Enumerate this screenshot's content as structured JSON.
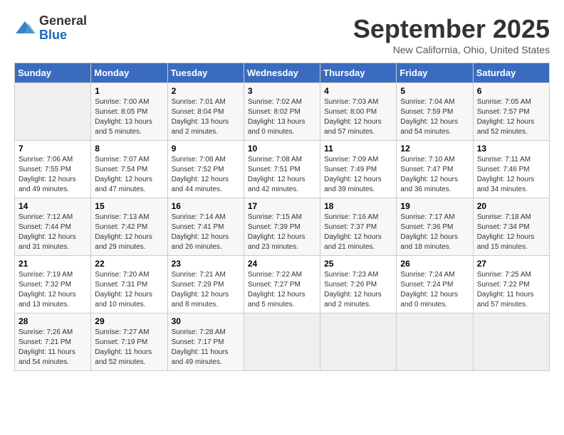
{
  "header": {
    "logo_line1": "General",
    "logo_line2": "Blue",
    "month_title": "September 2025",
    "location": "New California, Ohio, United States"
  },
  "days_of_week": [
    "Sunday",
    "Monday",
    "Tuesday",
    "Wednesday",
    "Thursday",
    "Friday",
    "Saturday"
  ],
  "weeks": [
    [
      {
        "day": "",
        "empty": true
      },
      {
        "day": "1",
        "sunrise": "7:00 AM",
        "sunset": "8:05 PM",
        "daylight": "13 hours and 5 minutes."
      },
      {
        "day": "2",
        "sunrise": "7:01 AM",
        "sunset": "8:04 PM",
        "daylight": "13 hours and 2 minutes."
      },
      {
        "day": "3",
        "sunrise": "7:02 AM",
        "sunset": "8:02 PM",
        "daylight": "13 hours and 0 minutes."
      },
      {
        "day": "4",
        "sunrise": "7:03 AM",
        "sunset": "8:00 PM",
        "daylight": "12 hours and 57 minutes."
      },
      {
        "day": "5",
        "sunrise": "7:04 AM",
        "sunset": "7:59 PM",
        "daylight": "12 hours and 54 minutes."
      },
      {
        "day": "6",
        "sunrise": "7:05 AM",
        "sunset": "7:57 PM",
        "daylight": "12 hours and 52 minutes."
      }
    ],
    [
      {
        "day": "7",
        "sunrise": "7:06 AM",
        "sunset": "7:55 PM",
        "daylight": "12 hours and 49 minutes."
      },
      {
        "day": "8",
        "sunrise": "7:07 AM",
        "sunset": "7:54 PM",
        "daylight": "12 hours and 47 minutes."
      },
      {
        "day": "9",
        "sunrise": "7:08 AM",
        "sunset": "7:52 PM",
        "daylight": "12 hours and 44 minutes."
      },
      {
        "day": "10",
        "sunrise": "7:08 AM",
        "sunset": "7:51 PM",
        "daylight": "12 hours and 42 minutes."
      },
      {
        "day": "11",
        "sunrise": "7:09 AM",
        "sunset": "7:49 PM",
        "daylight": "12 hours and 39 minutes."
      },
      {
        "day": "12",
        "sunrise": "7:10 AM",
        "sunset": "7:47 PM",
        "daylight": "12 hours and 36 minutes."
      },
      {
        "day": "13",
        "sunrise": "7:11 AM",
        "sunset": "7:46 PM",
        "daylight": "12 hours and 34 minutes."
      }
    ],
    [
      {
        "day": "14",
        "sunrise": "7:12 AM",
        "sunset": "7:44 PM",
        "daylight": "12 hours and 31 minutes."
      },
      {
        "day": "15",
        "sunrise": "7:13 AM",
        "sunset": "7:42 PM",
        "daylight": "12 hours and 29 minutes."
      },
      {
        "day": "16",
        "sunrise": "7:14 AM",
        "sunset": "7:41 PM",
        "daylight": "12 hours and 26 minutes."
      },
      {
        "day": "17",
        "sunrise": "7:15 AM",
        "sunset": "7:39 PM",
        "daylight": "12 hours and 23 minutes."
      },
      {
        "day": "18",
        "sunrise": "7:16 AM",
        "sunset": "7:37 PM",
        "daylight": "12 hours and 21 minutes."
      },
      {
        "day": "19",
        "sunrise": "7:17 AM",
        "sunset": "7:36 PM",
        "daylight": "12 hours and 18 minutes."
      },
      {
        "day": "20",
        "sunrise": "7:18 AM",
        "sunset": "7:34 PM",
        "daylight": "12 hours and 15 minutes."
      }
    ],
    [
      {
        "day": "21",
        "sunrise": "7:19 AM",
        "sunset": "7:32 PM",
        "daylight": "12 hours and 13 minutes."
      },
      {
        "day": "22",
        "sunrise": "7:20 AM",
        "sunset": "7:31 PM",
        "daylight": "12 hours and 10 minutes."
      },
      {
        "day": "23",
        "sunrise": "7:21 AM",
        "sunset": "7:29 PM",
        "daylight": "12 hours and 8 minutes."
      },
      {
        "day": "24",
        "sunrise": "7:22 AM",
        "sunset": "7:27 PM",
        "daylight": "12 hours and 5 minutes."
      },
      {
        "day": "25",
        "sunrise": "7:23 AM",
        "sunset": "7:26 PM",
        "daylight": "12 hours and 2 minutes."
      },
      {
        "day": "26",
        "sunrise": "7:24 AM",
        "sunset": "7:24 PM",
        "daylight": "12 hours and 0 minutes."
      },
      {
        "day": "27",
        "sunrise": "7:25 AM",
        "sunset": "7:22 PM",
        "daylight": "11 hours and 57 minutes."
      }
    ],
    [
      {
        "day": "28",
        "sunrise": "7:26 AM",
        "sunset": "7:21 PM",
        "daylight": "11 hours and 54 minutes."
      },
      {
        "day": "29",
        "sunrise": "7:27 AM",
        "sunset": "7:19 PM",
        "daylight": "11 hours and 52 minutes."
      },
      {
        "day": "30",
        "sunrise": "7:28 AM",
        "sunset": "7:17 PM",
        "daylight": "11 hours and 49 minutes."
      },
      {
        "day": "",
        "empty": true
      },
      {
        "day": "",
        "empty": true
      },
      {
        "day": "",
        "empty": true
      },
      {
        "day": "",
        "empty": true
      }
    ]
  ]
}
